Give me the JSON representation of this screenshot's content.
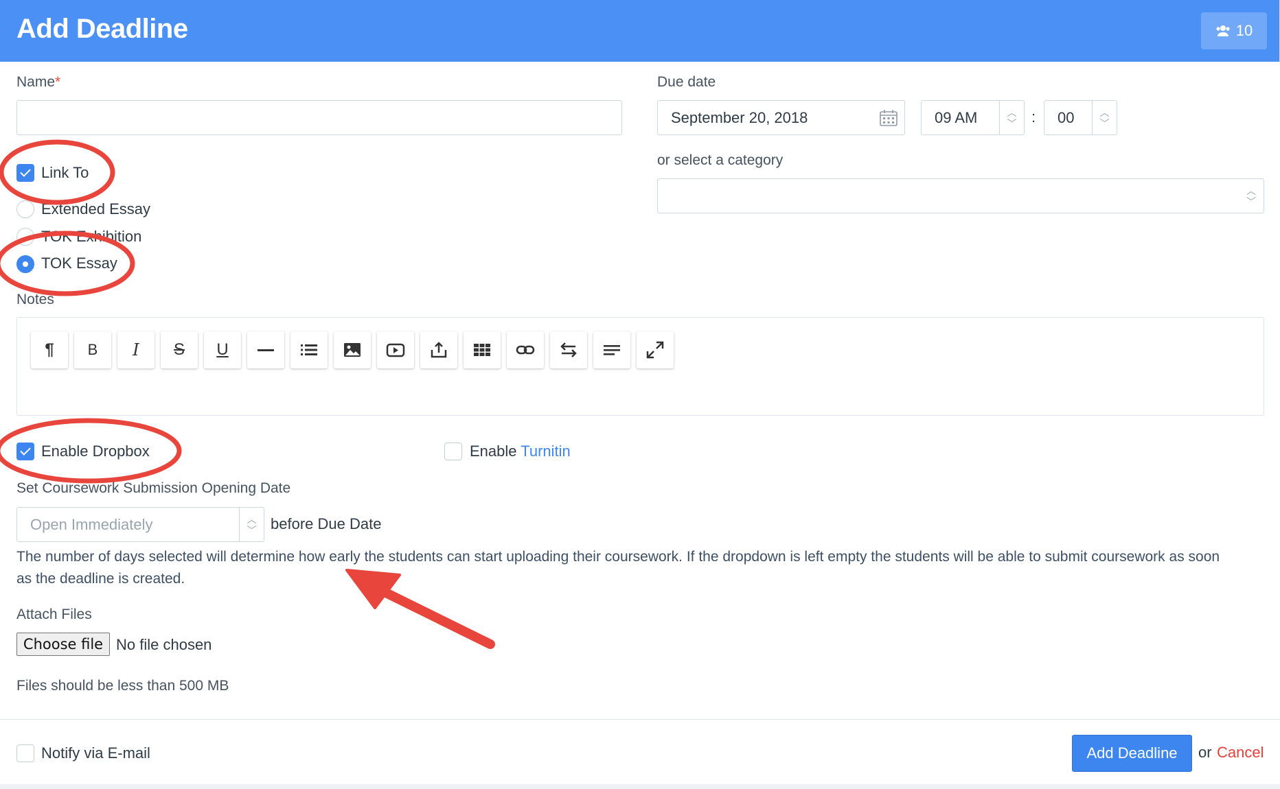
{
  "header": {
    "title": "Add Deadline",
    "members_count": "10"
  },
  "form": {
    "name": {
      "label": "Name",
      "required_mark": "*",
      "value": ""
    },
    "due_date": {
      "label": "Due date",
      "date": "September 20, 2018",
      "hour": "09 AM",
      "separator": ":",
      "minute": "00"
    },
    "category": {
      "label": "or select a category",
      "value": ""
    },
    "link_to": {
      "label": "Link To",
      "checked": true,
      "options": [
        {
          "label": "Extended Essay",
          "selected": false
        },
        {
          "label": "TOK Exhibition",
          "selected": false
        },
        {
          "label": "TOK Essay",
          "selected": true
        }
      ]
    },
    "notes": {
      "label": "Notes"
    },
    "enable_dropbox": {
      "label": "Enable Dropbox",
      "checked": true
    },
    "enable_turnitin": {
      "label_prefix": "Enable",
      "label_link": "Turnitin",
      "checked": false
    },
    "opening_date": {
      "label": "Set Coursework Submission Opening Date",
      "placeholder": "Open Immediately",
      "suffix": "before Due Date",
      "help": "The number of days selected will determine how early the students can start uploading their coursework. If the dropdown is left empty the students will be able to submit coursework as soon as the deadline is created."
    },
    "attach": {
      "label": "Attach Files",
      "button": "Choose file",
      "status": "No file chosen",
      "hint": "Files should be less than 500 MB"
    }
  },
  "toolbar": [
    "paragraph-icon",
    "bold-icon",
    "italic-icon",
    "strikethrough-icon",
    "underline-icon",
    "horizontal-rule-icon",
    "bullet-list-icon",
    "image-icon",
    "video-icon",
    "upload-icon",
    "table-icon",
    "link-icon",
    "direction-icon",
    "align-icon",
    "fullscreen-icon"
  ],
  "footer": {
    "notify_label": "Notify via E-mail",
    "notify_checked": false,
    "submit": "Add Deadline",
    "or": "or",
    "cancel": "Cancel"
  },
  "colors": {
    "header": "#4a90f5",
    "primary": "#3d86ef",
    "cancel": "#e5413b",
    "annotation": "#e8453c"
  }
}
